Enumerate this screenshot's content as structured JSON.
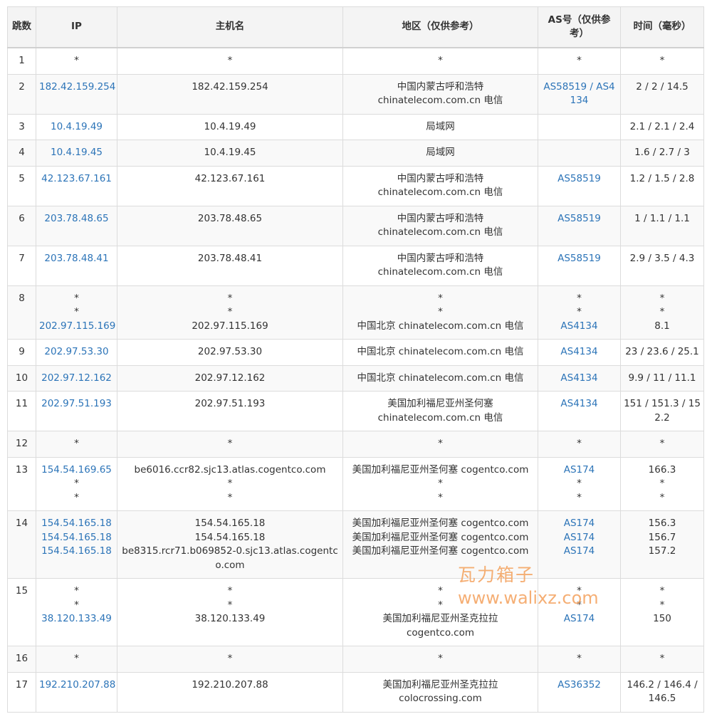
{
  "headers": {
    "hop": "跳数",
    "ip": "IP",
    "host": "主机名",
    "region": "地区（仅供参考）",
    "as": "AS号（仅供参考）",
    "time": "时间（毫秒）"
  },
  "rows": [
    {
      "hop": "1",
      "ip": [
        "*"
      ],
      "host": [
        "*"
      ],
      "region": [
        "*"
      ],
      "as": [
        "*"
      ],
      "time": [
        "*"
      ]
    },
    {
      "hop": "2",
      "ip": [
        "182.42.159.254"
      ],
      "host": [
        "182.42.159.254"
      ],
      "region": [
        "中国内蒙古呼和浩特",
        "chinatelecom.com.cn 电信"
      ],
      "as": [
        "AS58519 / AS4134"
      ],
      "time": [
        "2 / 2 / 14.5"
      ]
    },
    {
      "hop": "3",
      "ip": [
        "10.4.19.49"
      ],
      "host": [
        "10.4.19.49"
      ],
      "region": [
        "局域网"
      ],
      "as": [],
      "time": [
        "2.1 / 2.1 / 2.4"
      ]
    },
    {
      "hop": "4",
      "ip": [
        "10.4.19.45"
      ],
      "host": [
        "10.4.19.45"
      ],
      "region": [
        "局域网"
      ],
      "as": [],
      "time": [
        "1.6 / 2.7 / 3"
      ]
    },
    {
      "hop": "5",
      "ip": [
        "42.123.67.161"
      ],
      "host": [
        "42.123.67.161"
      ],
      "region": [
        "中国内蒙古呼和浩特",
        "chinatelecom.com.cn 电信"
      ],
      "as": [
        "AS58519"
      ],
      "time": [
        "1.2 / 1.5 / 2.8"
      ]
    },
    {
      "hop": "6",
      "ip": [
        "203.78.48.65"
      ],
      "host": [
        "203.78.48.65"
      ],
      "region": [
        "中国内蒙古呼和浩特",
        "chinatelecom.com.cn 电信"
      ],
      "as": [
        "AS58519"
      ],
      "time": [
        "1 / 1.1 / 1.1"
      ]
    },
    {
      "hop": "7",
      "ip": [
        "203.78.48.41"
      ],
      "host": [
        "203.78.48.41"
      ],
      "region": [
        "中国内蒙古呼和浩特",
        "chinatelecom.com.cn 电信"
      ],
      "as": [
        "AS58519"
      ],
      "time": [
        "2.9 / 3.5 / 4.3"
      ]
    },
    {
      "hop": "8",
      "ip": [
        "*",
        "*",
        "202.97.115.169"
      ],
      "host": [
        "*",
        "*",
        "202.97.115.169"
      ],
      "region": [
        "*",
        "*",
        "中国北京 chinatelecom.com.cn 电信"
      ],
      "as": [
        "*",
        "*",
        "AS4134"
      ],
      "time": [
        "*",
        "*",
        "8.1"
      ]
    },
    {
      "hop": "9",
      "ip": [
        "202.97.53.30"
      ],
      "host": [
        "202.97.53.30"
      ],
      "region": [
        "中国北京 chinatelecom.com.cn 电信"
      ],
      "as": [
        "AS4134"
      ],
      "time": [
        "23 / 23.6 / 25.1"
      ]
    },
    {
      "hop": "10",
      "ip": [
        "202.97.12.162"
      ],
      "host": [
        "202.97.12.162"
      ],
      "region": [
        "中国北京 chinatelecom.com.cn 电信"
      ],
      "as": [
        "AS4134"
      ],
      "time": [
        "9.9 / 11 / 11.1"
      ]
    },
    {
      "hop": "11",
      "ip": [
        "202.97.51.193"
      ],
      "host": [
        "202.97.51.193"
      ],
      "region": [
        "美国加利福尼亚州圣何塞",
        "chinatelecom.com.cn 电信"
      ],
      "as": [
        "AS4134"
      ],
      "time": [
        "151 / 151.3 / 152.2"
      ]
    },
    {
      "hop": "12",
      "ip": [
        "*"
      ],
      "host": [
        "*"
      ],
      "region": [
        "*"
      ],
      "as": [
        "*"
      ],
      "time": [
        "*"
      ]
    },
    {
      "hop": "13",
      "ip": [
        "154.54.169.65",
        "*",
        "*"
      ],
      "host": [
        "be6016.ccr82.sjc13.atlas.cogentco.com",
        "*",
        "*"
      ],
      "region": [
        "美国加利福尼亚州圣何塞 cogentco.com",
        "*",
        "*"
      ],
      "as": [
        "AS174",
        "*",
        "*"
      ],
      "time": [
        "166.3",
        "*",
        "*"
      ]
    },
    {
      "hop": "14",
      "ip": [
        "154.54.165.18",
        "154.54.165.18",
        "154.54.165.18"
      ],
      "host": [
        "154.54.165.18",
        "154.54.165.18",
        "be8315.rcr71.b069852-0.sjc13.atlas.cogentco.com"
      ],
      "region": [
        "美国加利福尼亚州圣何塞 cogentco.com",
        "美国加利福尼亚州圣何塞 cogentco.com",
        "美国加利福尼亚州圣何塞 cogentco.com"
      ],
      "as": [
        "AS174",
        "AS174",
        "AS174"
      ],
      "time": [
        "156.3",
        "156.7",
        "157.2"
      ]
    },
    {
      "hop": "15",
      "ip": [
        "*",
        "*",
        "38.120.133.49"
      ],
      "host": [
        "*",
        "*",
        "38.120.133.49"
      ],
      "region": [
        "*",
        "*",
        "美国加利福尼亚州圣克拉拉",
        "cogentco.com"
      ],
      "as": [
        "*",
        "*",
        "AS174"
      ],
      "time": [
        "*",
        "*",
        "150"
      ]
    },
    {
      "hop": "16",
      "ip": [
        "*"
      ],
      "host": [
        "*"
      ],
      "region": [
        "*"
      ],
      "as": [
        "*"
      ],
      "time": [
        "*"
      ]
    },
    {
      "hop": "17",
      "ip": [
        "192.210.207.88"
      ],
      "host": [
        "192.210.207.88"
      ],
      "region": [
        "美国加利福尼亚州圣克拉拉",
        "colocrossing.com"
      ],
      "as": [
        "AS36352"
      ],
      "time": [
        "146.2 / 146.4 / 146.5"
      ]
    }
  ],
  "watermark": {
    "line1": "瓦力箱子",
    "line2": "www.walixz.com"
  },
  "colors": {
    "link": "#2c74b8",
    "header_bg": "#f4f4f4",
    "border": "#dcdcdc",
    "watermark": "#f4a15c"
  }
}
